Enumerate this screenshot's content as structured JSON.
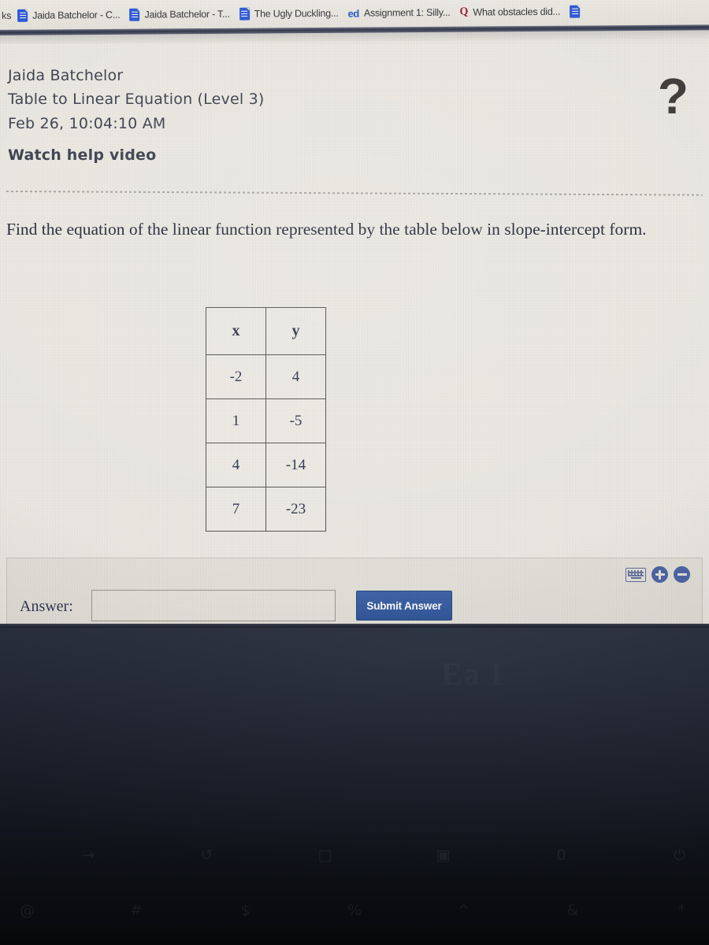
{
  "browser": {
    "bookmarks_label_truncated": "ks",
    "bookmarks": [
      {
        "icon": "google-docs-icon",
        "label": "Jaida Batchelor - C..."
      },
      {
        "icon": "google-docs-icon",
        "label": "Jaida Batchelor - T..."
      },
      {
        "icon": "google-docs-icon",
        "label": "The Ugly Duckling..."
      },
      {
        "icon": "edpuzzle-icon",
        "label": "Assignment 1: Silly..."
      },
      {
        "icon": "quizizz-icon",
        "label": "What obstacles did..."
      }
    ],
    "overflow_icon": "google-docs-icon"
  },
  "assignment": {
    "student_name": "Jaida Batchelor",
    "title": "Table to Linear Equation (Level 3)",
    "timestamp": "Feb 26, 10:04:10 AM",
    "help_video_link": "Watch help video",
    "help_icon": "?"
  },
  "question": {
    "prompt": "Find the equation of the linear function represented by the table below in slope-intercept form."
  },
  "chart_data": {
    "type": "table",
    "title": "",
    "columns": [
      "x",
      "y"
    ],
    "rows": [
      [
        "-2",
        "4"
      ],
      [
        "1",
        "-5"
      ],
      [
        "4",
        "-14"
      ],
      [
        "7",
        "-23"
      ]
    ],
    "x": [
      -2,
      1,
      4,
      7
    ],
    "y": [
      4,
      -5,
      -14,
      -23
    ]
  },
  "answer_bar": {
    "label": "Answer:",
    "input_value": "",
    "input_placeholder": "",
    "submit_label": "Submit Answer",
    "tools": [
      {
        "name": "keyboard-icon"
      },
      {
        "name": "zoom-in-icon"
      },
      {
        "name": "zoom-out-icon"
      }
    ]
  },
  "laptop": {
    "glare_text": "Ea I",
    "function_row_keys": [
      "",
      "→",
      "",
      "↺",
      "",
      "□",
      "",
      "▣",
      "",
      "0",
      "",
      "⏻"
    ],
    "number_row_keys": [
      "@",
      "",
      "#",
      "",
      "$",
      "",
      "%",
      "",
      "^",
      "",
      "&",
      "",
      "*"
    ]
  },
  "colors": {
    "screen_bg": "#eceae3",
    "accent_blue": "#2e5499",
    "bookmark_icon_blue": "#2b58d8",
    "text_navy": "#2d3550",
    "laptop_dark": "#141821"
  }
}
